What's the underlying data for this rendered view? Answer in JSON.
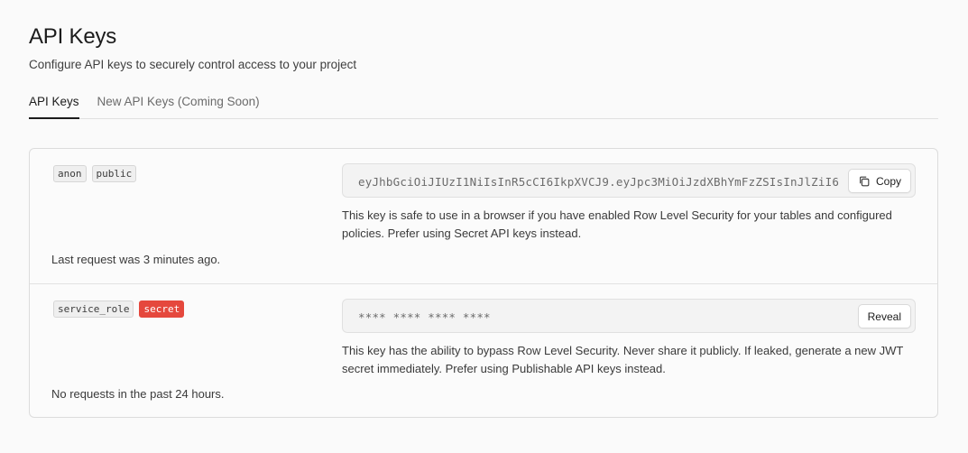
{
  "header": {
    "title": "API Keys",
    "subtitle": "Configure API keys to securely control access to your project"
  },
  "tabs": [
    {
      "label": "API Keys",
      "active": true
    },
    {
      "label": "New API Keys (Coming Soon)",
      "active": false
    }
  ],
  "keys": [
    {
      "badges": [
        "anon",
        "public"
      ],
      "value": "eyJhbGciOiJIUzI1NiIsInR5cCI6IkpXVCJ9.eyJpc3MiOiJzdXBhYmFzZSIsInJlZiI6",
      "button_label": "Copy",
      "button_icon": "copy-icon",
      "description": "This key is safe to use in a browser if you have enabled Row Level Security for your tables and configured policies. Prefer using Secret API keys instead.",
      "last_request": "Last request was 3 minutes ago."
    },
    {
      "badges": [
        "service_role",
        "secret"
      ],
      "value": "**** **** **** ****",
      "button_label": "Reveal",
      "description": "This key has the ability to bypass Row Level Security. Never share it publicly. If leaked, generate a new JWT secret immediately. Prefer using Publishable API keys instead.",
      "last_request": "No requests in the past 24 hours."
    }
  ],
  "colors": {
    "secret_badge": "#e5483d",
    "active_tab_underline": "#1c1c1c"
  }
}
